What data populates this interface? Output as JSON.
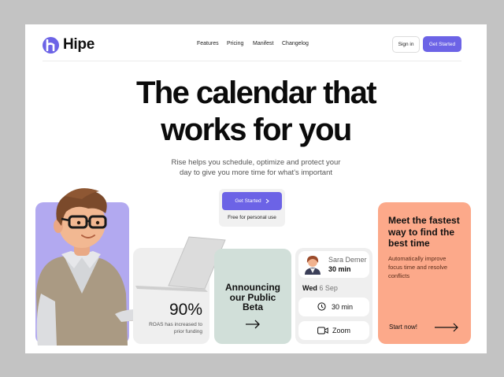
{
  "brand": {
    "name": "Hipe",
    "accent": "#6c63e6"
  },
  "nav": {
    "links": [
      "Features",
      "Pricing",
      "Manifest",
      "Changelog"
    ],
    "sign_in": "Sign in",
    "get_started": "Get Started"
  },
  "hero": {
    "title_line1": "The calendar that",
    "title_line2": "works for you",
    "subtitle_line1": "Rise helps you schedule, optimize and protect your",
    "subtitle_line2": "day to give you more time for what's important",
    "cta_label": "Get Started",
    "cta_note": "Free for personal use"
  },
  "stat": {
    "value": "90%",
    "desc_line1": "ROAS has increased to",
    "desc_line2": "prior funding"
  },
  "beta": {
    "line1": "Announcing",
    "line2": "our Public",
    "line3": "Beta"
  },
  "schedule": {
    "person_name": "Sara Demer",
    "person_duration": "30 min",
    "day": "Wed",
    "date": "6 Sep",
    "duration_option": "30 min",
    "meeting_app": "Zoom"
  },
  "promo": {
    "title_line1": "Meet the fastest",
    "title_line2": "way to find the",
    "title_line3": "best time",
    "desc_line1": "Automatically improve",
    "desc_line2": "focus time and resolve",
    "desc_line3": "conflicts",
    "link": "Start now!"
  },
  "colors": {
    "purple_card": "#b2a9f0",
    "beta_card": "#d1dfd9",
    "promo_card": "#fca98a"
  }
}
